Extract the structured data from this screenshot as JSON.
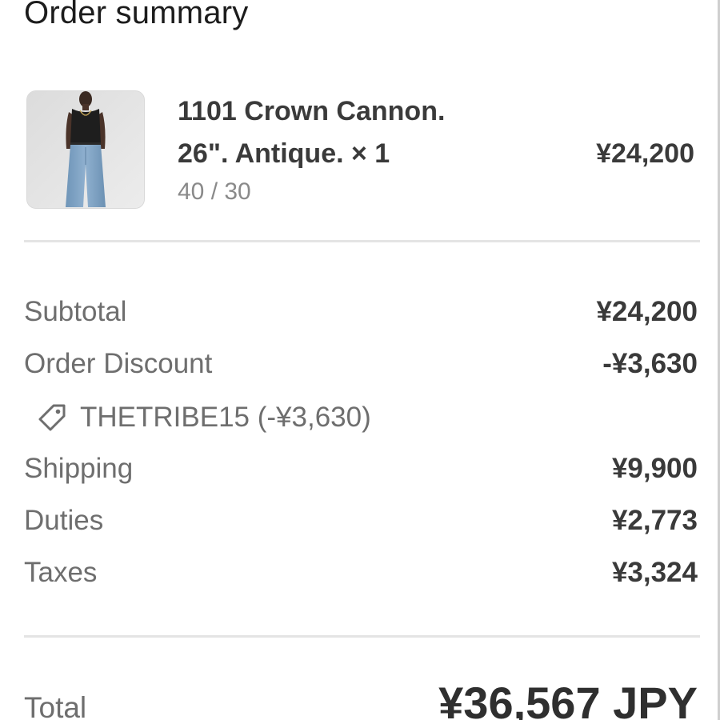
{
  "header": {
    "title": "Order summary"
  },
  "product": {
    "name_line1": "1101 Crown Cannon.",
    "name_line2": "26\". Antique. × 1",
    "variant": "40 / 30",
    "price": "¥24,200"
  },
  "summary": {
    "subtotal_label": "Subtotal",
    "subtotal_value": "¥24,200",
    "discount_label": "Order Discount",
    "discount_value": "-¥3,630",
    "discount_code": "THETRIBE15 (-¥3,630)",
    "discount_icon": "tag-icon",
    "shipping_label": "Shipping",
    "shipping_value": "¥9,900",
    "duties_label": "Duties",
    "duties_value": "¥2,773",
    "taxes_label": "Taxes",
    "taxes_value": "¥3,324"
  },
  "total": {
    "label": "Total",
    "value": "¥36,567 JPY"
  }
}
